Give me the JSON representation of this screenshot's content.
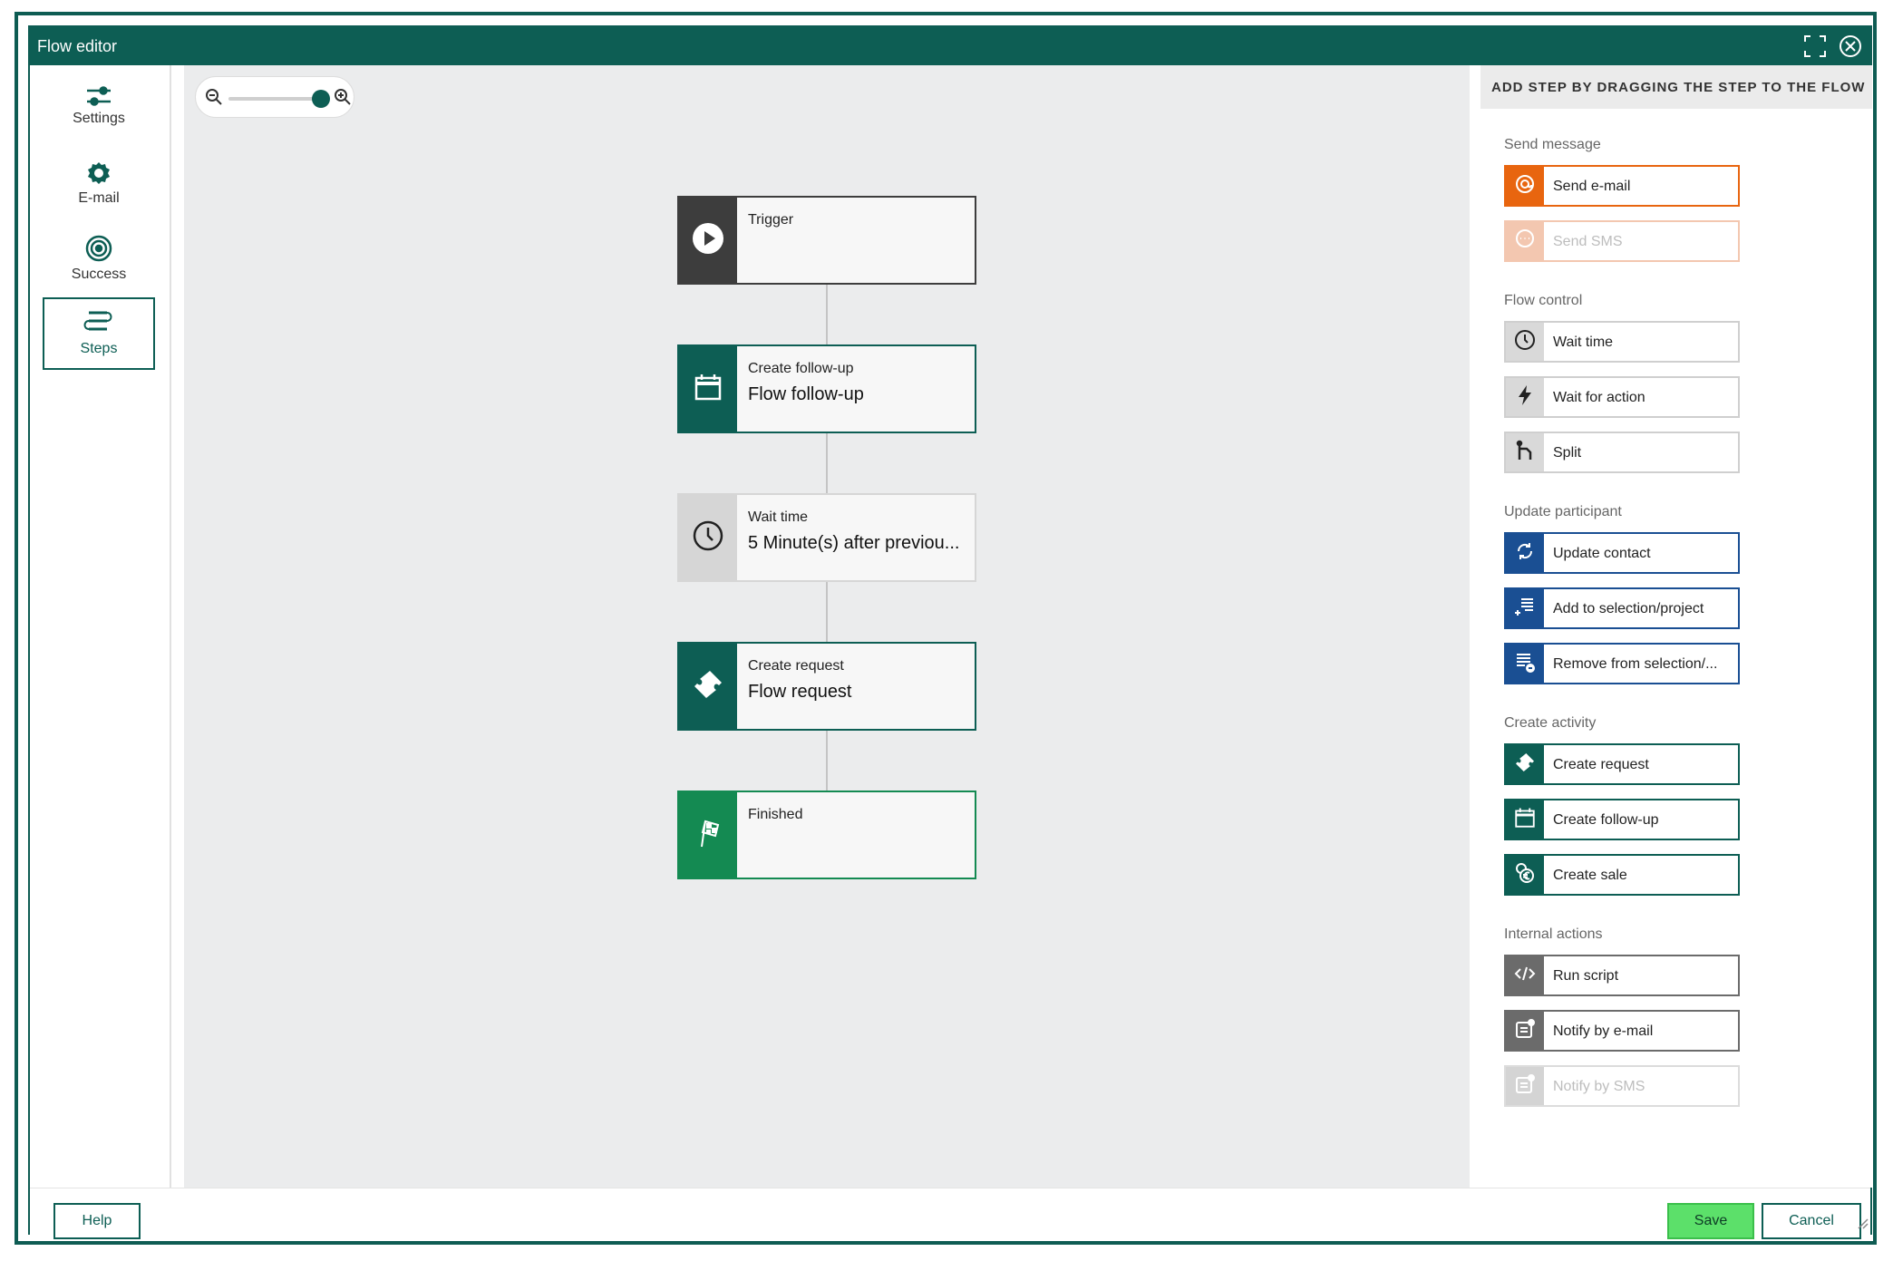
{
  "window": {
    "title": "Flow editor"
  },
  "sidebar": {
    "items": [
      {
        "label": "Settings",
        "icon": "sliders-icon",
        "active": false
      },
      {
        "label": "E-mail",
        "icon": "gear-icon",
        "active": false
      },
      {
        "label": "Success",
        "icon": "target-icon",
        "active": false
      },
      {
        "label": "Steps",
        "icon": "steps-icon",
        "active": true
      }
    ]
  },
  "canvas": {
    "zoom_level": 1.0,
    "nodes": [
      {
        "title": "Trigger",
        "subtitle": "",
        "icon": "play-icon",
        "color": "#3d3d3d"
      },
      {
        "title": "Create follow-up",
        "subtitle": "Flow follow-up",
        "icon": "calendar-icon",
        "color": "#0d5e54"
      },
      {
        "title": "Wait time",
        "subtitle": "5 Minute(s) after previou...",
        "icon": "clock-icon",
        "color": "#d6d6d6"
      },
      {
        "title": "Create request",
        "subtitle": "Flow request",
        "icon": "ticket-icon",
        "color": "#0d5e54"
      },
      {
        "title": "Finished",
        "subtitle": "",
        "icon": "checkered-flag-icon",
        "color": "#148a52"
      }
    ]
  },
  "step_panel": {
    "header": "ADD STEP BY DRAGGING THE STEP TO THE FLOW",
    "groups": [
      {
        "label": "Send message",
        "steps": [
          {
            "label": "Send e-mail",
            "icon": "at-icon",
            "color": "#e8650f",
            "disabled": false
          },
          {
            "label": "Send SMS",
            "icon": "chat-icon",
            "color": "#f3c7b0",
            "disabled": true
          }
        ]
      },
      {
        "label": "Flow control",
        "steps": [
          {
            "label": "Wait time",
            "icon": "clock-icon",
            "color": "#d9d9d9",
            "disabled": false
          },
          {
            "label": "Wait for action",
            "icon": "lightning-icon",
            "color": "#d9d9d9",
            "disabled": false
          },
          {
            "label": "Split",
            "icon": "split-icon",
            "color": "#d9d9d9",
            "disabled": false
          }
        ]
      },
      {
        "label": "Update participant",
        "steps": [
          {
            "label": "Update contact",
            "icon": "refresh-icon",
            "color": "#1a4f93",
            "disabled": false
          },
          {
            "label": "Add to selection/project",
            "icon": "list-add-icon",
            "color": "#1a4f93",
            "disabled": false
          },
          {
            "label": "Remove from selection/...",
            "icon": "list-remove-icon",
            "color": "#1a4f93",
            "disabled": false
          }
        ]
      },
      {
        "label": "Create activity",
        "steps": [
          {
            "label": "Create request",
            "icon": "ticket-icon",
            "color": "#0d5e54",
            "disabled": false
          },
          {
            "label": "Create follow-up",
            "icon": "calendar-icon",
            "color": "#0d5e54",
            "disabled": false
          },
          {
            "label": "Create sale",
            "icon": "coins-icon",
            "color": "#0d5e54",
            "disabled": false
          }
        ]
      },
      {
        "label": "Internal actions",
        "steps": [
          {
            "label": "Run script",
            "icon": "code-icon",
            "color": "#6b6b6b",
            "disabled": false
          },
          {
            "label": "Notify by e-mail",
            "icon": "notify-icon",
            "color": "#6b6b6b",
            "disabled": false
          },
          {
            "label": "Notify by SMS",
            "icon": "notify-icon",
            "color": "#d4d4d4",
            "disabled": true
          }
        ]
      }
    ]
  },
  "footer": {
    "help_label": "Help",
    "save_label": "Save",
    "cancel_label": "Cancel"
  }
}
